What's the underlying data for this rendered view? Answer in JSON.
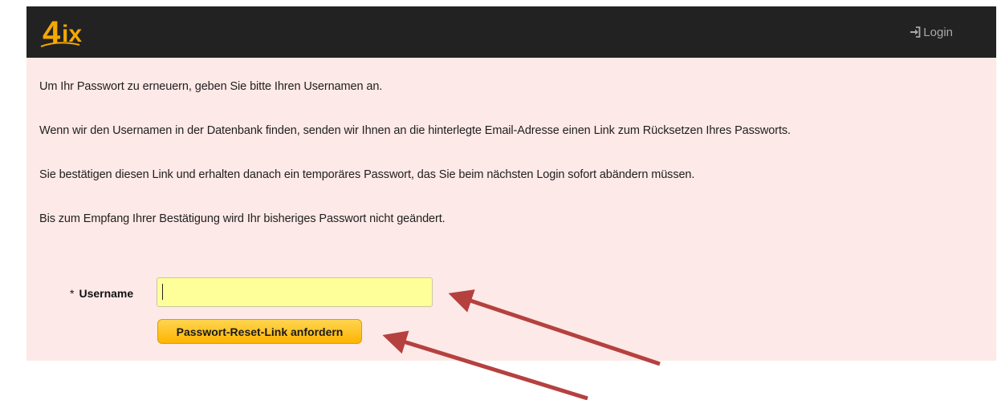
{
  "header": {
    "logo_text": "4ix",
    "login_label": "Login",
    "login_icon": "sign-in-icon"
  },
  "content": {
    "paragraphs": [
      "Um Ihr Passwort zu erneuern, geben Sie bitte Ihren Usernamen an.",
      "Wenn wir den Usernamen in der Datenbank finden, senden wir Ihnen an die hinterlegte Email-Adresse einen Link zum Rücksetzen Ihres Passworts.",
      "Sie bestätigen diesen Link und erhalten danach ein temporäres Passwort, das Sie beim nächsten Login sofort abändern müssen.",
      "Bis zum Empfang Ihrer Bestätigung wird Ihr bisheriges Passwort nicht geändert."
    ]
  },
  "form": {
    "required_marker": "*",
    "username_label": "Username",
    "username_value": "",
    "submit_label": "Passwort-Reset-Link anfordern"
  },
  "colors": {
    "navbar": "#222222",
    "panel": "#fde9e7",
    "input_bg": "#ffff99",
    "button": "#fdb400",
    "annotation_arrow": "#b5413f"
  }
}
